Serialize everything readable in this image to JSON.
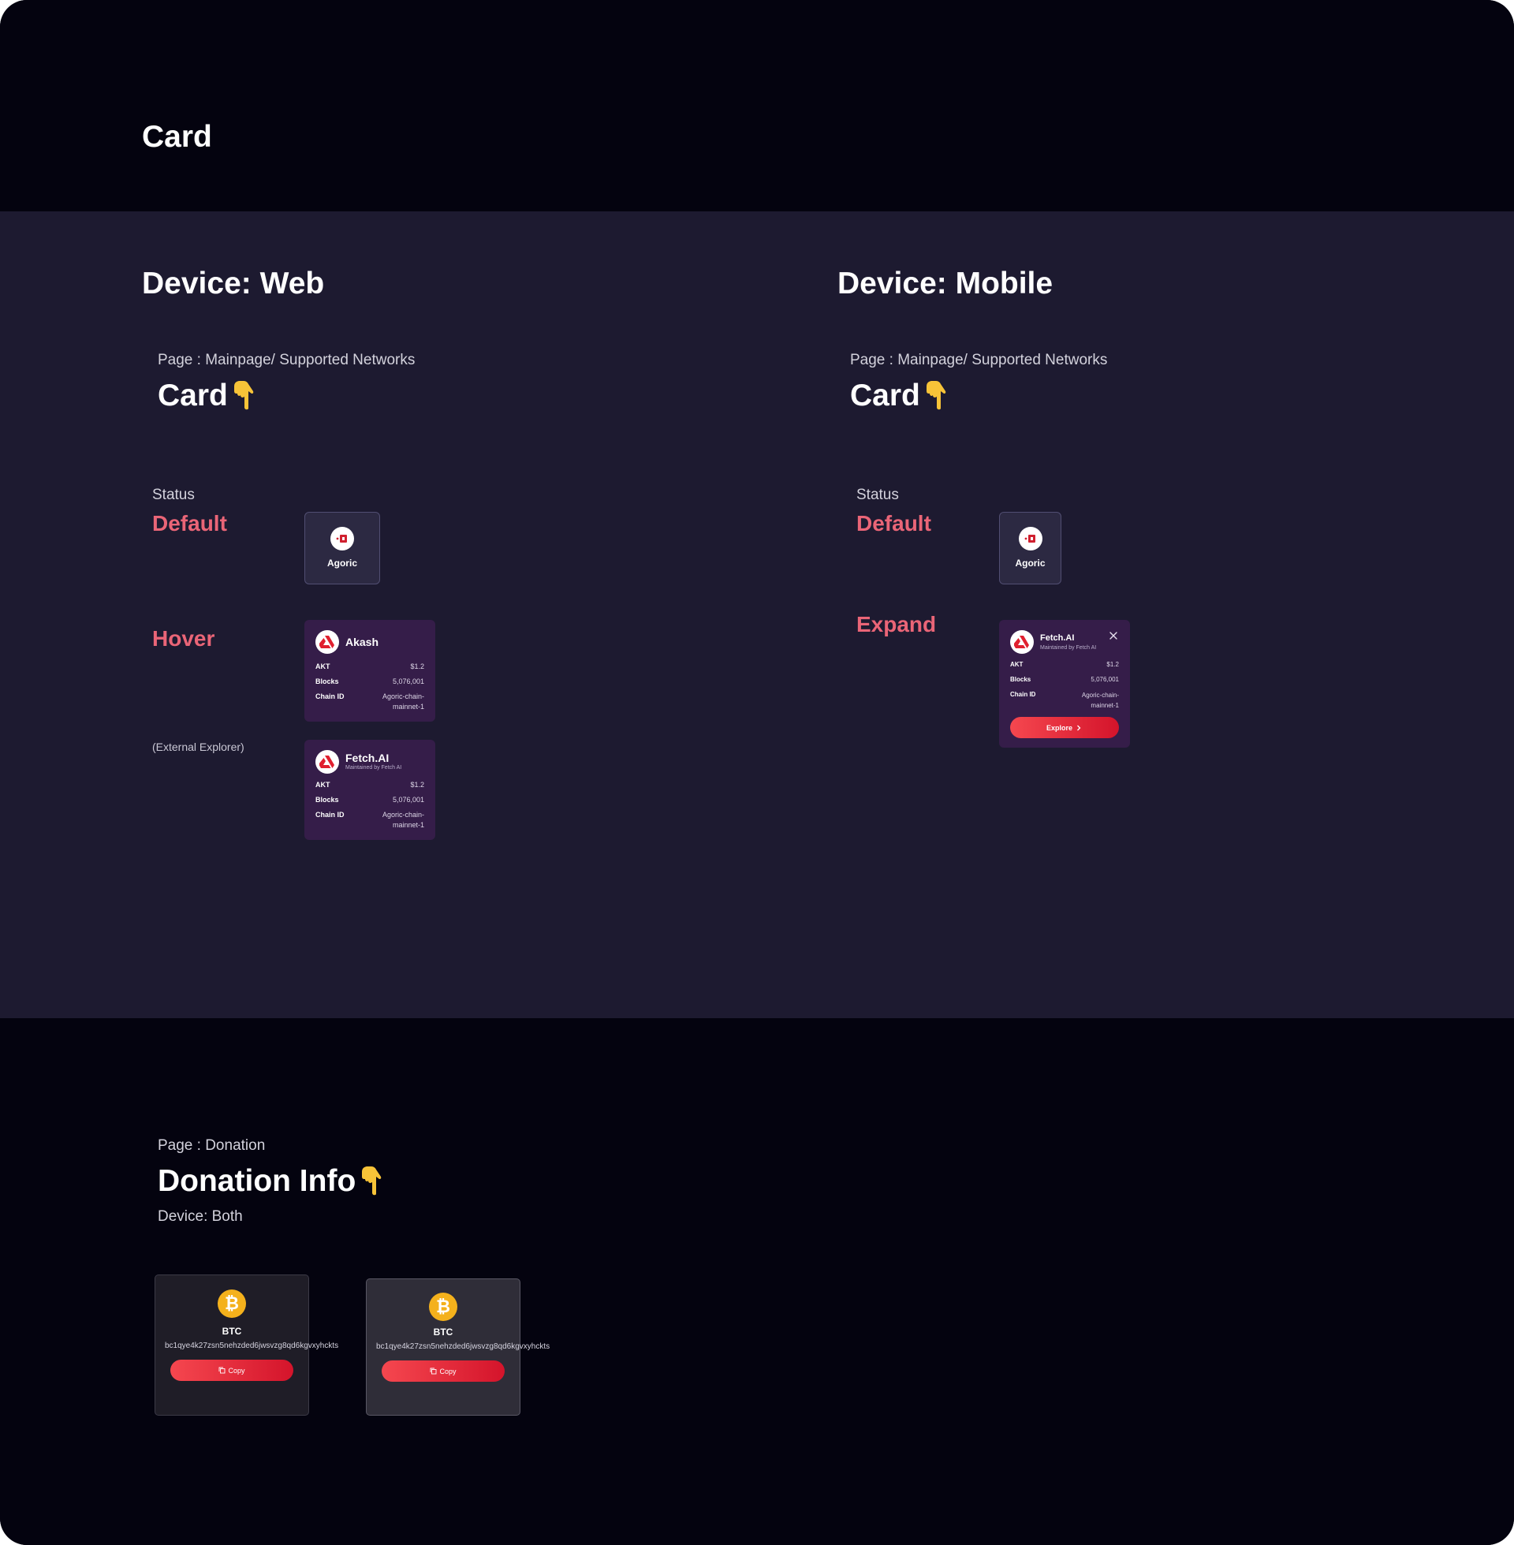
{
  "header": {
    "title": "Card"
  },
  "web": {
    "device_title": "Device: Web",
    "page_label": "Page : Mainpage/ Supported Networks",
    "card_heading": "Card",
    "status_label": "Status",
    "default_label": "Default",
    "hover_label": "Hover",
    "external_label": "(External Explorer)",
    "default_card": {
      "name": "Agoric"
    },
    "hover_card": {
      "name": "Akash",
      "rows": [
        {
          "k": "AKT",
          "v": "$1.2"
        },
        {
          "k": "Blocks",
          "v": "5,076,001"
        },
        {
          "k": "Chain ID",
          "v": "Agoric-chain-mainnet-1"
        }
      ]
    },
    "external_card": {
      "name": "Fetch.AI",
      "subtitle": "Maintained by Fetch AI",
      "rows": [
        {
          "k": "AKT",
          "v": "$1.2"
        },
        {
          "k": "Blocks",
          "v": "5,076,001"
        },
        {
          "k": "Chain ID",
          "v": "Agoric-chain-mainnet-1"
        }
      ]
    }
  },
  "mobile": {
    "device_title": "Device: Mobile",
    "page_label": "Page : Mainpage/ Supported Networks",
    "card_heading": "Card",
    "status_label": "Status",
    "default_label": "Default",
    "expand_label": "Expand",
    "default_card": {
      "name": "Agoric"
    },
    "expand_card": {
      "name": "Fetch.AI",
      "subtitle": "Maintained by Fetch AI",
      "rows": [
        {
          "k": "AKT",
          "v": "$1.2"
        },
        {
          "k": "Blocks",
          "v": "5,076,001"
        },
        {
          "k": "Chain ID",
          "v": "Agoric-chain-mainnet-1"
        }
      ],
      "button_label": "Explore"
    }
  },
  "donation": {
    "page_label": "Page : Donation",
    "heading": "Donation Info",
    "device_label": "Device: Both",
    "cards": [
      {
        "symbol": "BTC",
        "address": "bc1qye4k27zsn5nehzded6jwsvzg8qd6kgvxyhckts",
        "button_label": "Copy"
      },
      {
        "symbol": "BTC",
        "address": "bc1qye4k27zsn5nehzded6jwsvzg8qd6kgvxyhckts",
        "button_label": "Copy"
      }
    ]
  },
  "icons": {
    "pointer": "pointing-down-hand-icon",
    "agoric": "agoric-logo-icon",
    "akash": "akash-logo-icon",
    "btc": "bitcoin-logo-icon",
    "close": "close-icon",
    "copy": "copy-icon",
    "chevron": "chevron-right-icon"
  },
  "colors": {
    "background_dark": "#04030f",
    "background_mid": "#1d1a30",
    "accent_pink": "#ea6577",
    "card_purple": "#351d49",
    "button_red": "#e52a3b",
    "btc_orange": "#f4b11c"
  }
}
